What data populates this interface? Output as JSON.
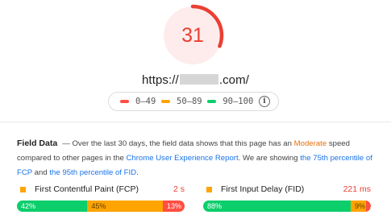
{
  "gauge": {
    "score": "31",
    "score_fraction": 0.31,
    "color": "#eb3f33",
    "track_color": "#fdeceb"
  },
  "page": {
    "url_prefix": "https://",
    "url_suffix": ".com/"
  },
  "legend": {
    "items": [
      {
        "label": "0–49",
        "color": "#ff4e42"
      },
      {
        "label": "50–89",
        "color": "#ffa400"
      },
      {
        "label": "90–100",
        "color": "#0cce6b"
      }
    ],
    "info_icon": "info-icon"
  },
  "field_data": {
    "title": "Field Data",
    "text_1": "— Over the last 30 days, the field data shows that this page has an ",
    "rating": "Moderate",
    "text_2": " speed compared to other pages in the ",
    "link_report": "Chrome User Experience Report",
    "text_3": ". We are showing ",
    "link_fcp": "the 75th percentile of FCP",
    "text_4": " and ",
    "link_fid": "the 95th percentile of FID",
    "text_5": "."
  },
  "metrics": [
    {
      "name": "First Contentful Paint (FCP)",
      "value": "2 s",
      "distribution": [
        {
          "label": "42%",
          "percent": 42,
          "color": "#0cce6b"
        },
        {
          "label": "45%",
          "percent": 45,
          "color": "#ffa400"
        },
        {
          "label": "13%",
          "percent": 13,
          "color": "#ff4e42"
        }
      ]
    },
    {
      "name": "First Input Delay (FID)",
      "value": "221 ms",
      "distribution": [
        {
          "label": "88%",
          "percent": 88,
          "color": "#0cce6b"
        },
        {
          "label": "9%",
          "percent": 9,
          "color": "#ffa400"
        },
        {
          "label": "3%",
          "percent": 3,
          "color": "#ff4e42"
        }
      ]
    }
  ]
}
